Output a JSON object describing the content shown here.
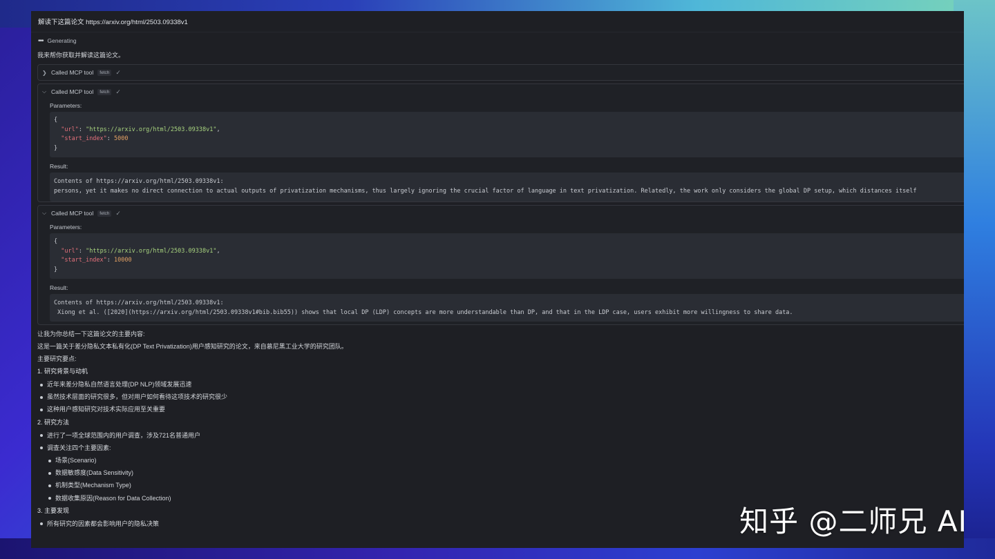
{
  "window": {
    "title": "解读下这篇论文 https://arxiv.org/html/2503.09338v1",
    "status": "Generating",
    "intro": "我来帮你获取并解读这篇论文。"
  },
  "tools": [
    {
      "label": "Called MCP tool",
      "badge": "fetch"
    },
    {
      "label": "Called MCP tool",
      "badge": "fetch",
      "params_label": "Parameters:",
      "url_key": "\"url\"",
      "url_val": "\"https://arxiv.org/html/2503.09338v1\"",
      "idx_key": "\"start_index\"",
      "idx_val": "5000",
      "result_label": "Result:",
      "result_line1": "Contents of https://arxiv.org/html/2503.09338v1:",
      "result_line2": "persons, yet it makes no direct connection to actual outputs of privatization mechanisms, thus largely ignoring the crucial factor of language in text privatization. Relatedly, the work only considers the global DP setup, which distances itself"
    },
    {
      "label": "Called MCP tool",
      "badge": "fetch",
      "params_label": "Parameters:",
      "url_key": "\"url\"",
      "url_val": "\"https://arxiv.org/html/2503.09338v1\"",
      "idx_key": "\"start_index\"",
      "idx_val": "10000",
      "result_label": "Result:",
      "result_line1": "Contents of https://arxiv.org/html/2503.09338v1:",
      "result_line2": " Xiong et al. ([2020](https://arxiv.org/html/2503.09338v1#bib.bib55)) shows that local DP (LDP) concepts are more understandable than DP, and that in the LDP case, users exhibit more willingness to share data."
    }
  ],
  "summary": {
    "lead": "让我为你总结一下这篇论文的主要内容:",
    "about": "这是一篇关于差分隐私文本私有化(DP Text Privatization)用户感知研究的论文，来自慕尼黑工业大学的研究团队。",
    "points_title": "主要研究要点:",
    "s1_title": "1. 研究背景与动机",
    "s1_items": [
      "近年来差分隐私自然语言处理(DP NLP)领域发展迅速",
      "虽然技术层面的研究很多，但对用户如何看待这项技术的研究很少",
      "这种用户感知研究对技术实际应用至关重要"
    ],
    "s2_title": "2. 研究方法",
    "s2_items": [
      "进行了一项全球范围内的用户调查，涉及721名普通用户",
      "调查关注四个主要因素:"
    ],
    "s2_sub": [
      "场景(Scenario)",
      "数据敏感度(Data Sensitivity)",
      "机制类型(Mechanism Type)",
      "数据收集原因(Reason for Data Collection)"
    ],
    "s3_title": "3. 主要发现",
    "s3_items": [
      "所有研究的因素都会影响用户的隐私决策"
    ]
  },
  "watermark": "知乎 @二师兄 AI"
}
